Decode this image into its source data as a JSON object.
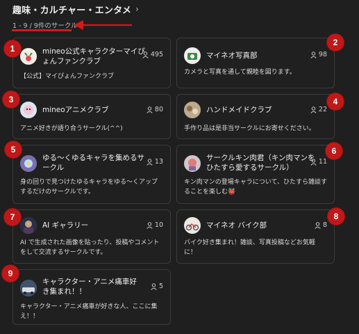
{
  "header": {
    "title": "趣味・カルチャー・エンタメ",
    "count": "1 - 9 / 9件のサークル"
  },
  "circles": [
    {
      "badge": "1",
      "name": "mineo公式キャラクターマイぴょんファンクラブ",
      "members": "495",
      "desc": "【公式】マイぴょんファンクラブ",
      "avatar_color": "#f3e3d3"
    },
    {
      "badge": "2",
      "name": "マイネオ写真部",
      "members": "98",
      "desc": "カメラと写真を通して親睦を図ります。",
      "avatar_color": "#e9ece8"
    },
    {
      "badge": "3",
      "name": "mineoアニメクラブ",
      "members": "80",
      "desc": "アニメ好きが語り合うサークル(^^)",
      "avatar_color": "#d7e2f0"
    },
    {
      "badge": "4",
      "name": "ハンドメイドクラブ",
      "members": "22",
      "desc": "手作り品は是非当サークルにお寄せください。",
      "avatar_color": "#c9b8a0"
    },
    {
      "badge": "5",
      "name": "ゆる～くゆるキャラを集めるサークル",
      "members": "13",
      "desc": "身の回りで見つけたゆるキャラをゆる～くアップするだけのサークルです。",
      "avatar_color": "#8a7fb8"
    },
    {
      "badge": "6",
      "name": "サークルキン肉君（キン肉マンをひたすら愛するサークル）",
      "members": "11",
      "desc": "キン肉マンの登場キャラについて、ひたすら雑談することを楽しむ👹",
      "avatar_color": "#c9c0c8"
    },
    {
      "badge": "7",
      "name": "AI ギャラリー",
      "members": "10",
      "desc": "AI で生成された画像を貼ったり、投稿やコメントをして交流するサークルです。",
      "avatar_color": "#3a3f55"
    },
    {
      "badge": "8",
      "name": "マイネオ バイク部",
      "members": "8",
      "desc": "バイク好き集まれ！雑談、写真投稿などお気軽に！",
      "avatar_color": "#e8e4e0"
    },
    {
      "badge": "9",
      "name": "キャラクター・アニメ痛車好き集まれ！！",
      "members": "5",
      "desc": "キャラクター・アニメ痛車が好きな人、ここに集え！！",
      "avatar_color": "#4a5f78"
    }
  ]
}
